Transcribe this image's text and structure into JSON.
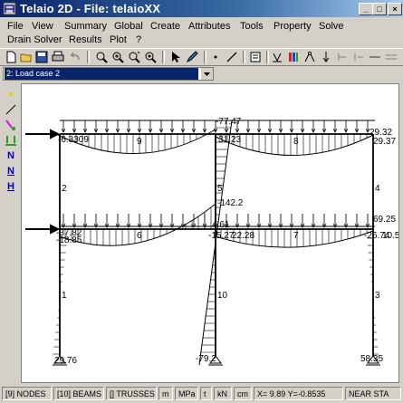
{
  "window": {
    "title": "Telaio 2D - File: telaioXX"
  },
  "menu": {
    "row1": [
      "File",
      "View",
      "Summary",
      "Global",
      "Create",
      "Attributes",
      "Tools",
      "Property",
      "Solve"
    ],
    "row2": [
      "Drain Solver",
      "Results",
      "Plot",
      "?"
    ]
  },
  "toolbar": {
    "icons": [
      "new-icon",
      "open-icon",
      "save-icon",
      "print-icon",
      "undo-icon",
      "zoom-out-icon",
      "zoom-in-icon",
      "zoom-window-icon",
      "zoom-extents-icon",
      "select-arrow-icon",
      "pencil-icon",
      "point-icon",
      "line-icon",
      "properties-icon",
      "supports-icon",
      "materials-icon",
      "hinge-icon",
      "load-icon",
      "edit-icon",
      "align-icon",
      "spring-icon",
      "section-icon"
    ]
  },
  "load_case": {
    "selected": "2: Load case 2"
  },
  "side_tools": {
    "labels": [
      "",
      "",
      "",
      "",
      "N",
      "N",
      "H"
    ]
  },
  "drawing": {
    "beam_labels": [
      "9",
      "8",
      "6",
      "7"
    ],
    "column_labels": [
      "2",
      "5",
      "4",
      "1",
      "10",
      "3"
    ],
    "moment_values": [
      "-77.47",
      "-6.3309",
      "31.23",
      "29.32",
      "29.37",
      "-142.2",
      "69.25",
      "4.61",
      "-37.82",
      "-18.85",
      "-15.27",
      "22.28",
      "-26.74",
      "10.5",
      "29.76",
      "-79.2",
      "58.35"
    ],
    "diagram_color": "#000000",
    "load_color": "#000000"
  },
  "status": {
    "nodes": "[9] NODES",
    "beams": "[10] BEAMS",
    "trusses": "[] TRUSSES",
    "unit_length": "m",
    "unit_stress": "MPa",
    "unit_time": "t",
    "unit_force": "kN",
    "unit_section": "cm",
    "coords": "X= 9.89   Y=-0.8535",
    "snap": "NEAR STA"
  }
}
